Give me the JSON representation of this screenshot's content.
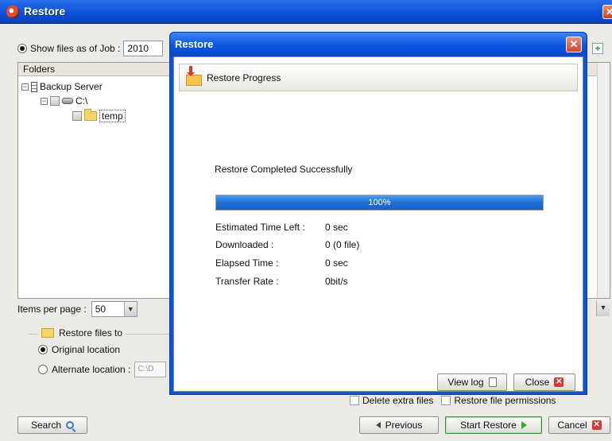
{
  "outer": {
    "title": "Restore",
    "job_label": "Show files as of Job :",
    "job_value": "2010",
    "folders_header": "Folders",
    "tree": {
      "server": "Backup Server",
      "drive": "C:\\",
      "folder": "temp"
    },
    "items_per_page_label": "Items per page :",
    "items_per_page_value": "50",
    "restore_to_label": "Restore files to",
    "original_location": "Original location",
    "alternate_location": "Alternate location :",
    "alternate_path": "C:\\D",
    "delete_extra_files": "Delete extra files",
    "restore_file_permissions": "Restore file permissions",
    "buttons": {
      "search": "Search",
      "previous": "Previous",
      "start_restore": "Start Restore",
      "cancel": "Cancel"
    }
  },
  "dialog": {
    "title": "Restore",
    "header": "Restore Progress",
    "status": "Restore Completed Successfully",
    "progress_label": "100%",
    "progress_fraction": 1.0,
    "stats": [
      {
        "label": "Estimated Time Left :",
        "value": "0 sec"
      },
      {
        "label": "Downloaded :",
        "value": "0 (0 file)"
      },
      {
        "label": "Elapsed Time :",
        "value": "0 sec"
      },
      {
        "label": "Transfer Rate :",
        "value": "0bit/s"
      }
    ],
    "buttons": {
      "view_log": "View log",
      "close": "Close"
    }
  },
  "colors": {
    "titlebar": "#0b54e0",
    "progress": "#1f6fd8",
    "start_restore_icon": "#2eaa2e",
    "cancel_icon": "#d83a3a"
  },
  "icons": [
    "restore-app-icon",
    "close-icon",
    "server-icon",
    "drive-icon",
    "folder-icon",
    "restore-folder-icon",
    "search-icon",
    "arrow-left-icon",
    "arrow-right-icon",
    "cancel-x-icon",
    "log-document-icon"
  ]
}
